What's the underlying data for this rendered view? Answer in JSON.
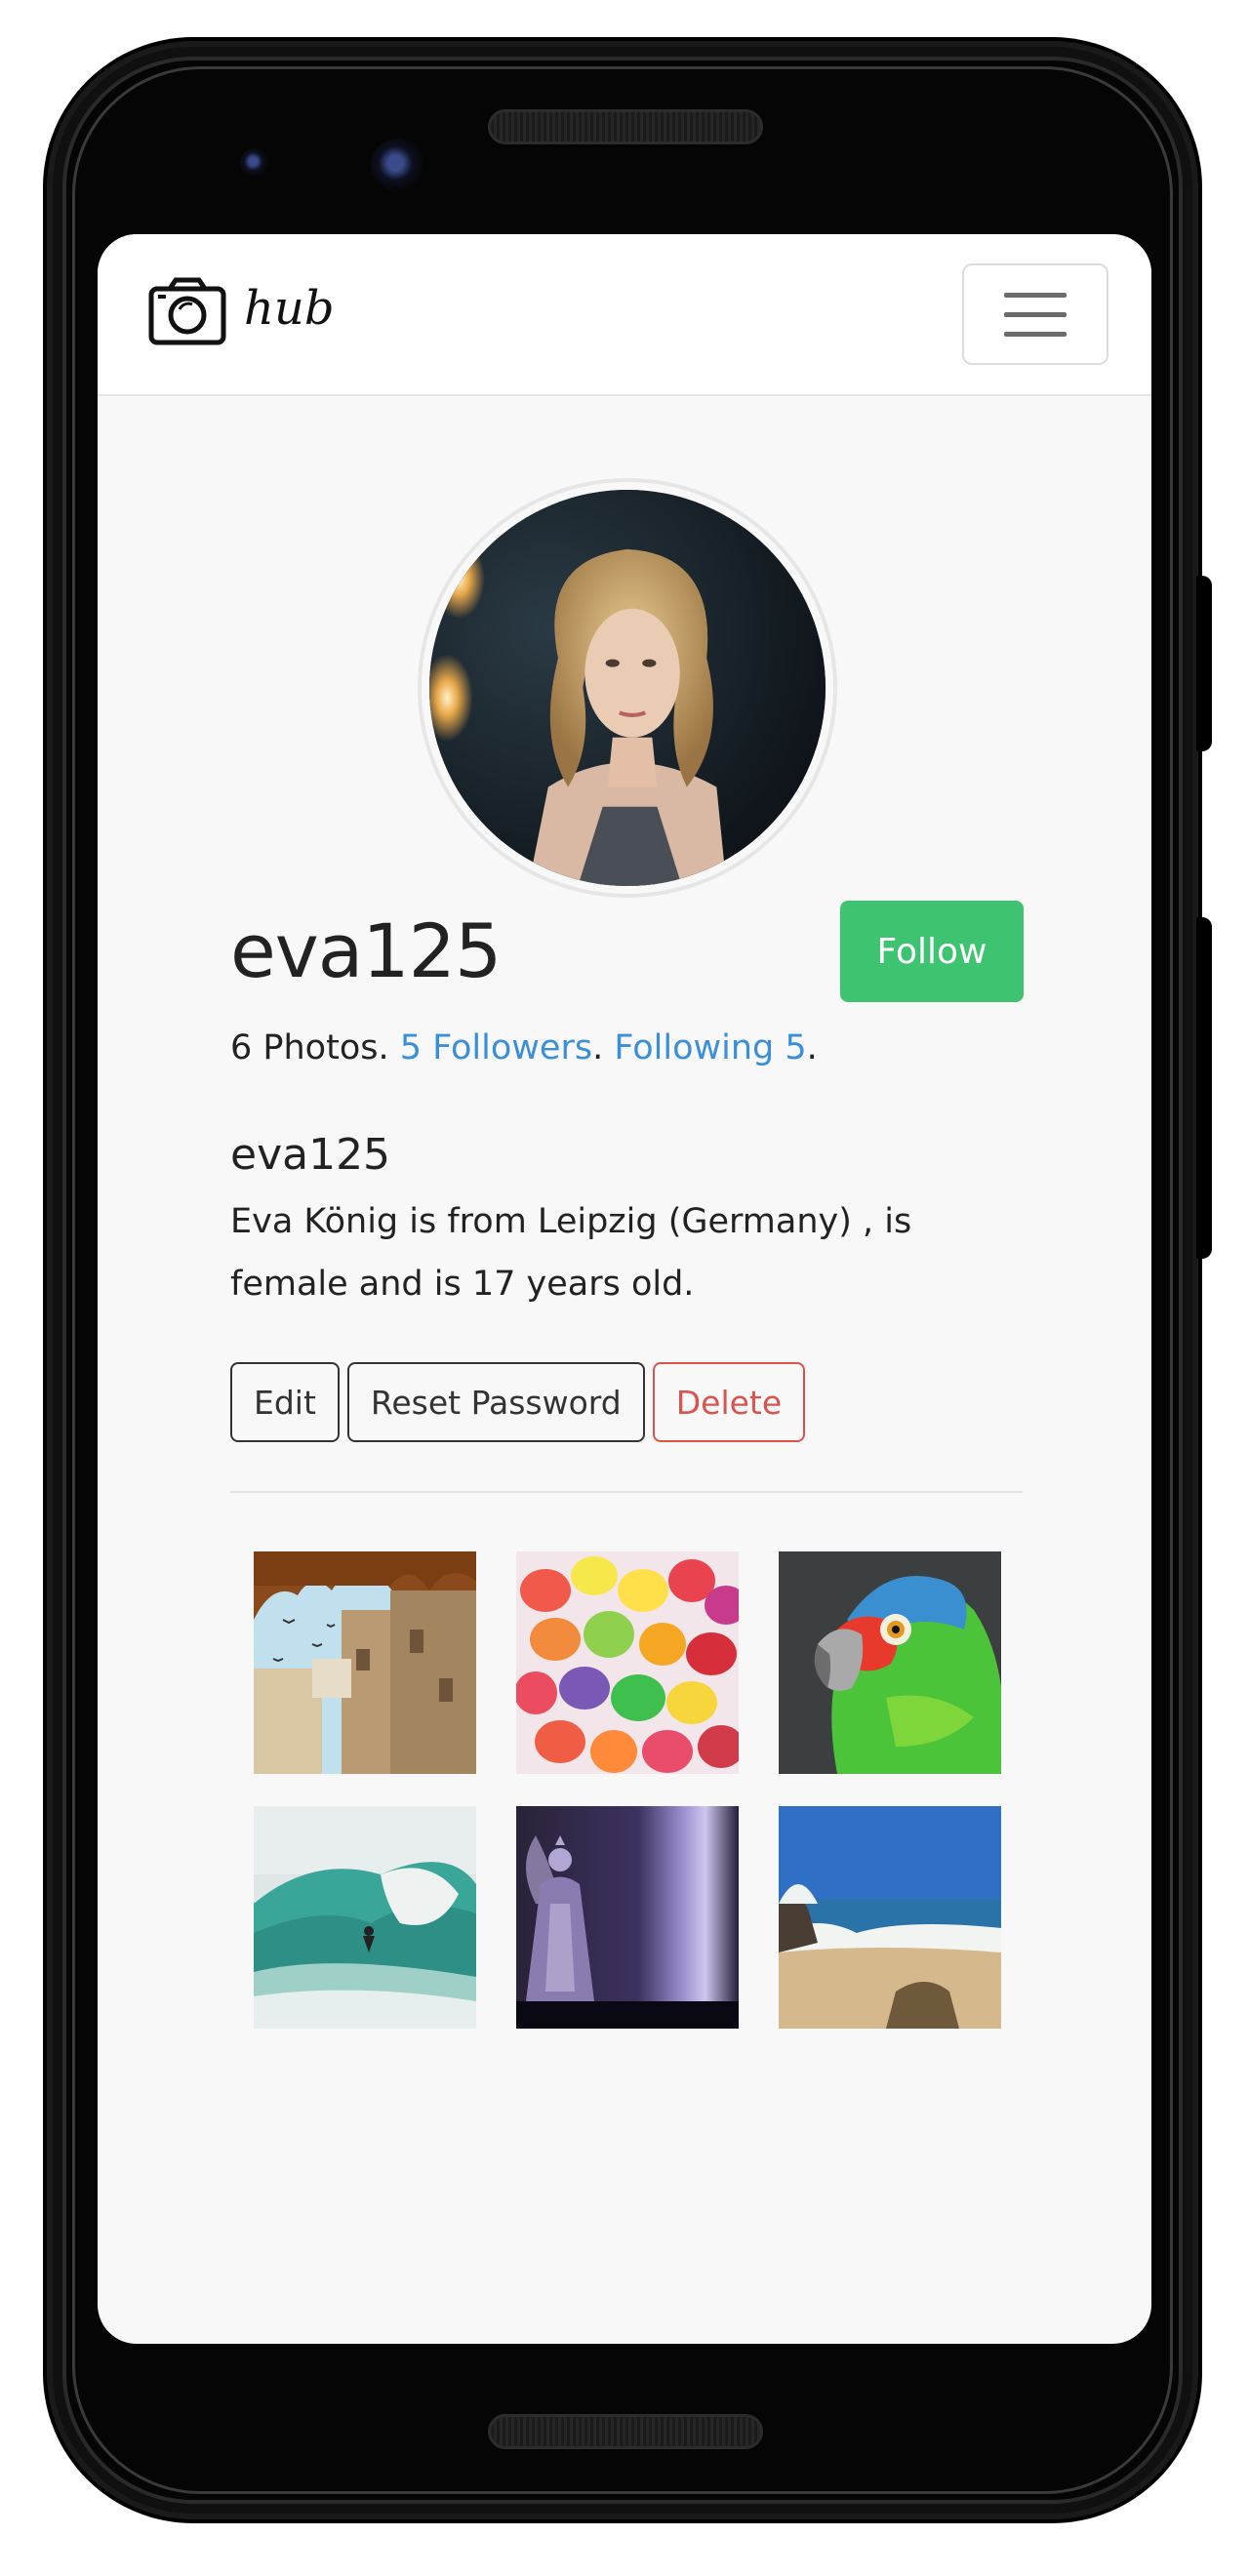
{
  "app": {
    "brand_name": "hub"
  },
  "profile": {
    "username": "eva125",
    "follow_label": "Follow",
    "stats": {
      "photos": "6 Photos",
      "followers": "5 Followers",
      "following": "Following 5",
      "sep1": ". ",
      "sep2": ". ",
      "sep3": "."
    },
    "bio_name": "eva125",
    "bio_text": "Eva König is from Leipzig (Germany) , is female and is 17 years old."
  },
  "actions": {
    "edit_label": "Edit",
    "reset_label": "Reset Password",
    "delete_label": "Delete"
  },
  "gallery": [
    {
      "subject": "palace-window"
    },
    {
      "subject": "candies"
    },
    {
      "subject": "parrot"
    },
    {
      "subject": "surf-wave"
    },
    {
      "subject": "glass-angel"
    },
    {
      "subject": "beach-coast"
    }
  ],
  "colors": {
    "follow_green": "#3ec371",
    "link_blue": "#3a8fd6",
    "danger_red": "#d9534f"
  }
}
